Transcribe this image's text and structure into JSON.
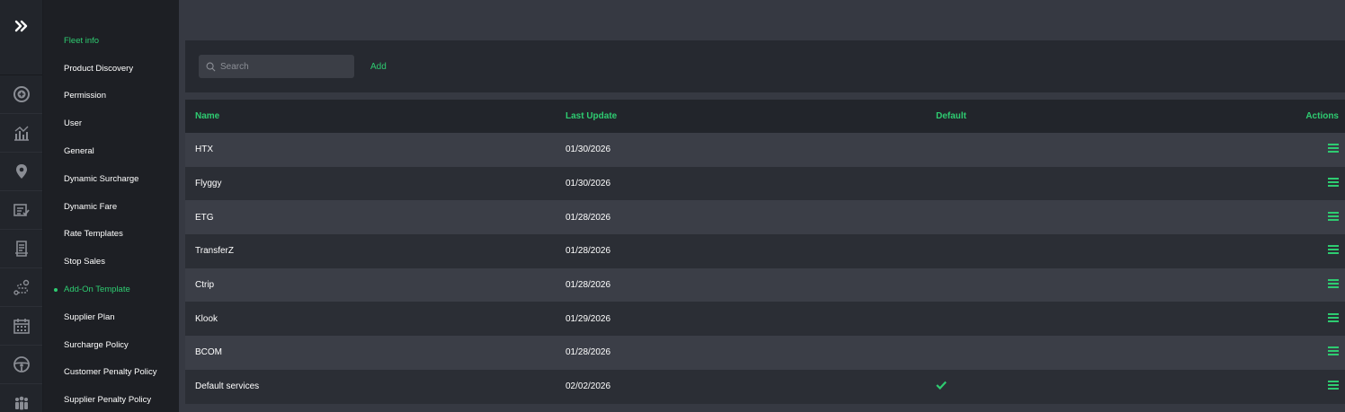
{
  "sidebar": {
    "items": [
      {
        "label": "Fleet info"
      },
      {
        "label": "Product Discovery"
      },
      {
        "label": "Permission"
      },
      {
        "label": "User"
      },
      {
        "label": "General"
      },
      {
        "label": "Dynamic Surcharge"
      },
      {
        "label": "Dynamic Fare"
      },
      {
        "label": "Rate Templates"
      },
      {
        "label": "Stop Sales"
      },
      {
        "label": "Add-On Template"
      },
      {
        "label": "Supplier Plan"
      },
      {
        "label": "Surcharge Policy"
      },
      {
        "label": "Customer Penalty Policy"
      },
      {
        "label": "Supplier Penalty Policy"
      }
    ],
    "active_index": 9
  },
  "rail": {
    "icons": [
      "expand-icon",
      "plus-circle-icon",
      "chart-icon",
      "location-pin-icon",
      "checklist-icon",
      "receipt-icon",
      "route-icon",
      "calendar-icon",
      "steering-wheel-icon",
      "users-icon"
    ]
  },
  "toolbar": {
    "search_placeholder": "Search",
    "add_label": "Add"
  },
  "table": {
    "headers": {
      "name": "Name",
      "last_update": "Last Update",
      "default": "Default",
      "actions": "Actions"
    },
    "rows": [
      {
        "name": "HTX",
        "last_update": "01/30/2026",
        "default": false
      },
      {
        "name": "Flyggy",
        "last_update": "01/30/2026",
        "default": false
      },
      {
        "name": "ETG",
        "last_update": "01/28/2026",
        "default": false
      },
      {
        "name": "TransferZ",
        "last_update": "01/28/2026",
        "default": false
      },
      {
        "name": "Ctrip",
        "last_update": "01/28/2026",
        "default": false
      },
      {
        "name": "Klook",
        "last_update": "01/29/2026",
        "default": false
      },
      {
        "name": "BCOM",
        "last_update": "01/28/2026",
        "default": false
      },
      {
        "name": "Default services",
        "last_update": "02/02/2026",
        "default": true
      }
    ]
  },
  "colors": {
    "accent": "#2ecc71",
    "sidebar_bg": "#1d1f24",
    "main_bg": "#363942"
  }
}
